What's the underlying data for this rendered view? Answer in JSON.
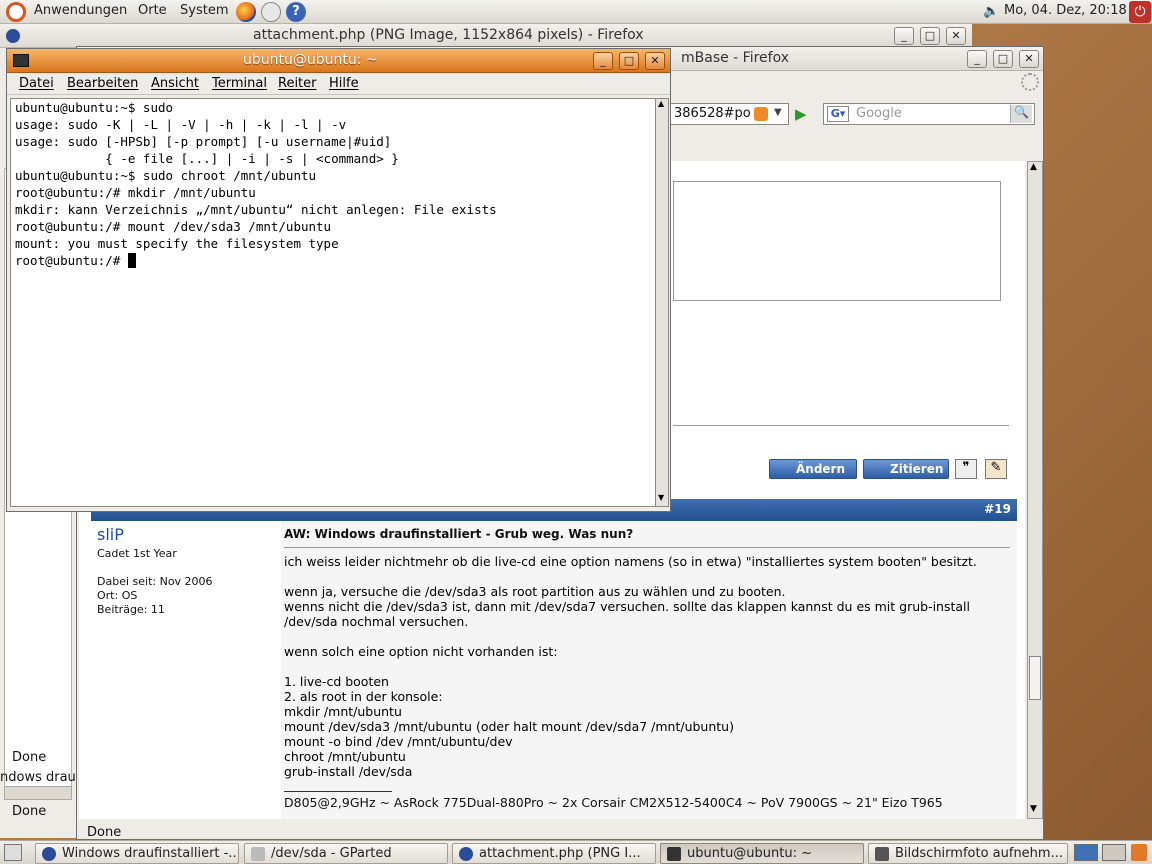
{
  "top_panel": {
    "menus": [
      "Anwendungen",
      "Orte",
      "System"
    ],
    "clock": "Mo, 04. Dez, 20:18"
  },
  "firefox_image_window": {
    "title": "attachment.php (PNG Image, 1152x864 pixels) - Firefox"
  },
  "firefox_forum_window": {
    "title_visible": "mBase - Firefox",
    "address_fragment": "386528#po",
    "search_placeholder": "Google",
    "status": "Done",
    "post_number": "#19",
    "author": "sliP",
    "rank": "Cadet 1st Year",
    "joined": "Dabei seit: Nov 2006",
    "location": "Ort: OS",
    "posts": "Beiträge: 11",
    "post_title": "AW: Windows draufinstalliert - Grub weg. Was nun?",
    "post_lines": [
      "ich weiss leider nichtmehr ob die live-cd eine option namens (so in etwa) \"installiertes system booten\" besitzt.",
      "",
      "wenn ja, versuche die /dev/sda3 als root partition aus zu wählen und zu booten.",
      "wenns nicht die /dev/sda3 ist, dann mit /dev/sda7 versuchen. sollte das klappen kannst du es mit grub-install",
      "/dev/sda nochmal versuchen.",
      "",
      "wenn solch eine option nicht vorhanden ist:",
      "",
      "1. live-cd booten",
      "2. als root in der konsole:",
      "mkdir /mnt/ubuntu",
      "mount /dev/sda3 /mnt/ubuntu (oder halt mount /dev/sda7 /mnt/ubuntu)",
      "mount -o bind /dev /mnt/ubuntu/dev",
      "chroot /mnt/ubuntu",
      "grub-install /dev/sda"
    ],
    "signature": "D805@2,9GHz ~ AsRock 775Dual-880Pro ~ 2x Corsair CM2X512-5400C4 ~ PoV 7900GS ~ 21\" Eizo T965",
    "buttons": {
      "edit": "Ändern",
      "quote": "Zitieren"
    }
  },
  "left_window": {
    "status1": "Done",
    "partial_text": "ndows drau",
    "status2": "Done"
  },
  "terminal": {
    "title": "ubuntu@ubuntu: ~",
    "menus": [
      "Datei",
      "Bearbeiten",
      "Ansicht",
      "Terminal",
      "Reiter",
      "Hilfe"
    ],
    "lines": [
      "ubuntu@ubuntu:~$ sudo",
      "usage: sudo -K | -L | -V | -h | -k | -l | -v",
      "usage: sudo [-HPSb] [-p prompt] [-u username|#uid]",
      "            { -e file [...] | -i | -s | <command> }",
      "ubuntu@ubuntu:~$ sudo chroot /mnt/ubuntu",
      "root@ubuntu:/# mkdir /mnt/ubuntu",
      "mkdir: kann Verzeichnis „/mnt/ubuntu“ nicht anlegen: File exists",
      "root@ubuntu:/# mount /dev/sda3 /mnt/ubuntu",
      "mount: you must specify the filesystem type"
    ],
    "prompt": "root@ubuntu:/# "
  },
  "taskbar": {
    "tasks": [
      "Windows draufinstalliert -...",
      "/dev/sda - GParted",
      "attachment.php (PNG I...",
      "ubuntu@ubuntu: ~",
      "Bildschirmfoto aufnehm..."
    ]
  }
}
